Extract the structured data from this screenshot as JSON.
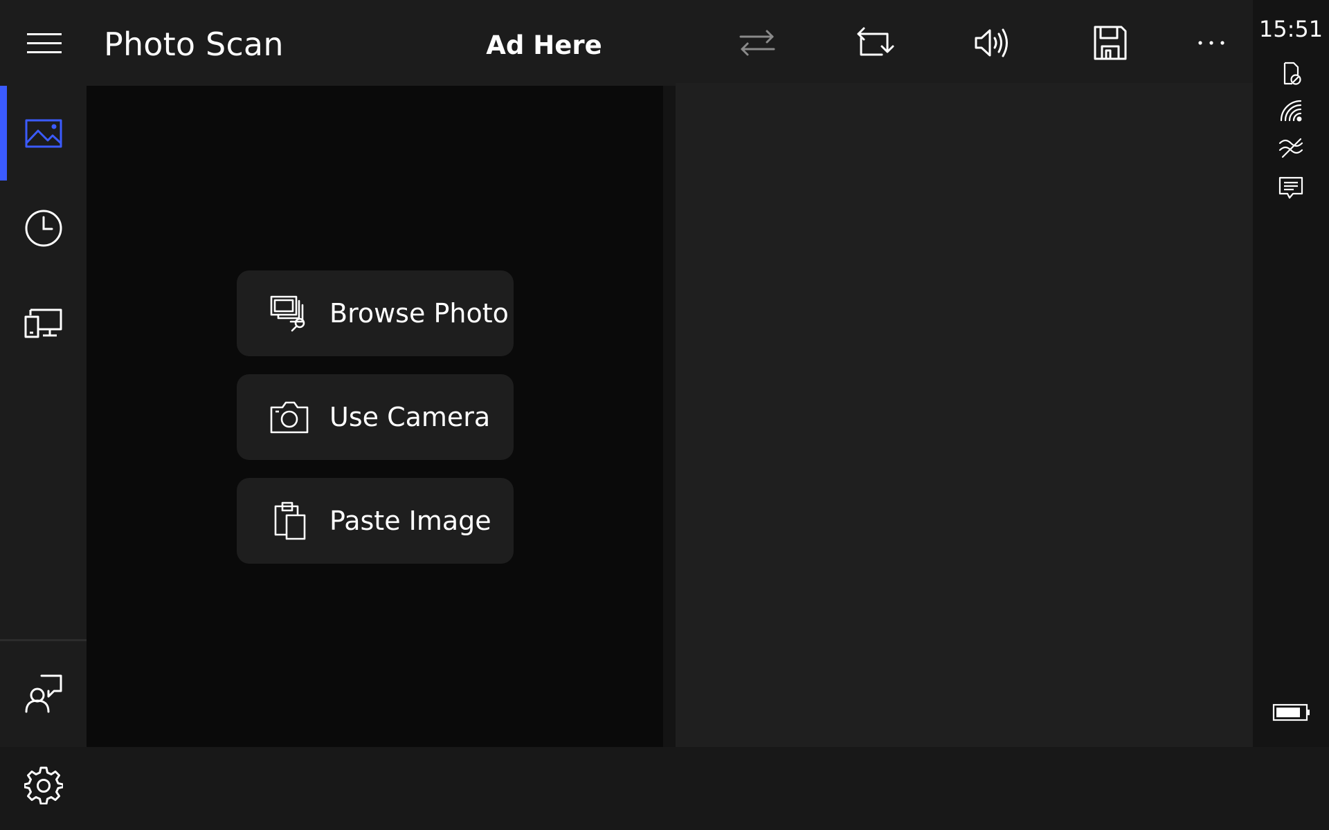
{
  "app": {
    "title": "Photo Scan"
  },
  "header": {
    "ad_text": "Ad Here",
    "toolbar": [
      {
        "name": "swap-button",
        "icon": "swap-arrows-icon"
      },
      {
        "name": "rotate-crop-button",
        "icon": "rotate-crop-icon"
      },
      {
        "name": "speak-button",
        "icon": "speaker-icon"
      },
      {
        "name": "save-button",
        "icon": "floppy-disk-icon"
      },
      {
        "name": "more-button",
        "icon": "more-dots-icon"
      }
    ]
  },
  "nav": {
    "items": [
      {
        "name": "nav-scan",
        "icon": "image-icon",
        "selected": true
      },
      {
        "name": "nav-history",
        "icon": "clock-icon",
        "selected": false
      },
      {
        "name": "nav-devices",
        "icon": "devices-icon",
        "selected": false
      },
      {
        "name": "nav-feedback",
        "icon": "feedback-person-icon",
        "selected": false
      },
      {
        "name": "nav-settings",
        "icon": "gear-icon",
        "selected": false
      }
    ],
    "accent": "#3b5bff"
  },
  "actions": {
    "browse_label": "Browse Photo",
    "camera_label": "Use Camera",
    "paste_label": "Paste Image"
  },
  "status": {
    "time": "15:51",
    "icons": [
      "no-sim-icon",
      "wifi-signal-icon",
      "data-sense-icon",
      "message-icon",
      "battery-icon"
    ]
  }
}
